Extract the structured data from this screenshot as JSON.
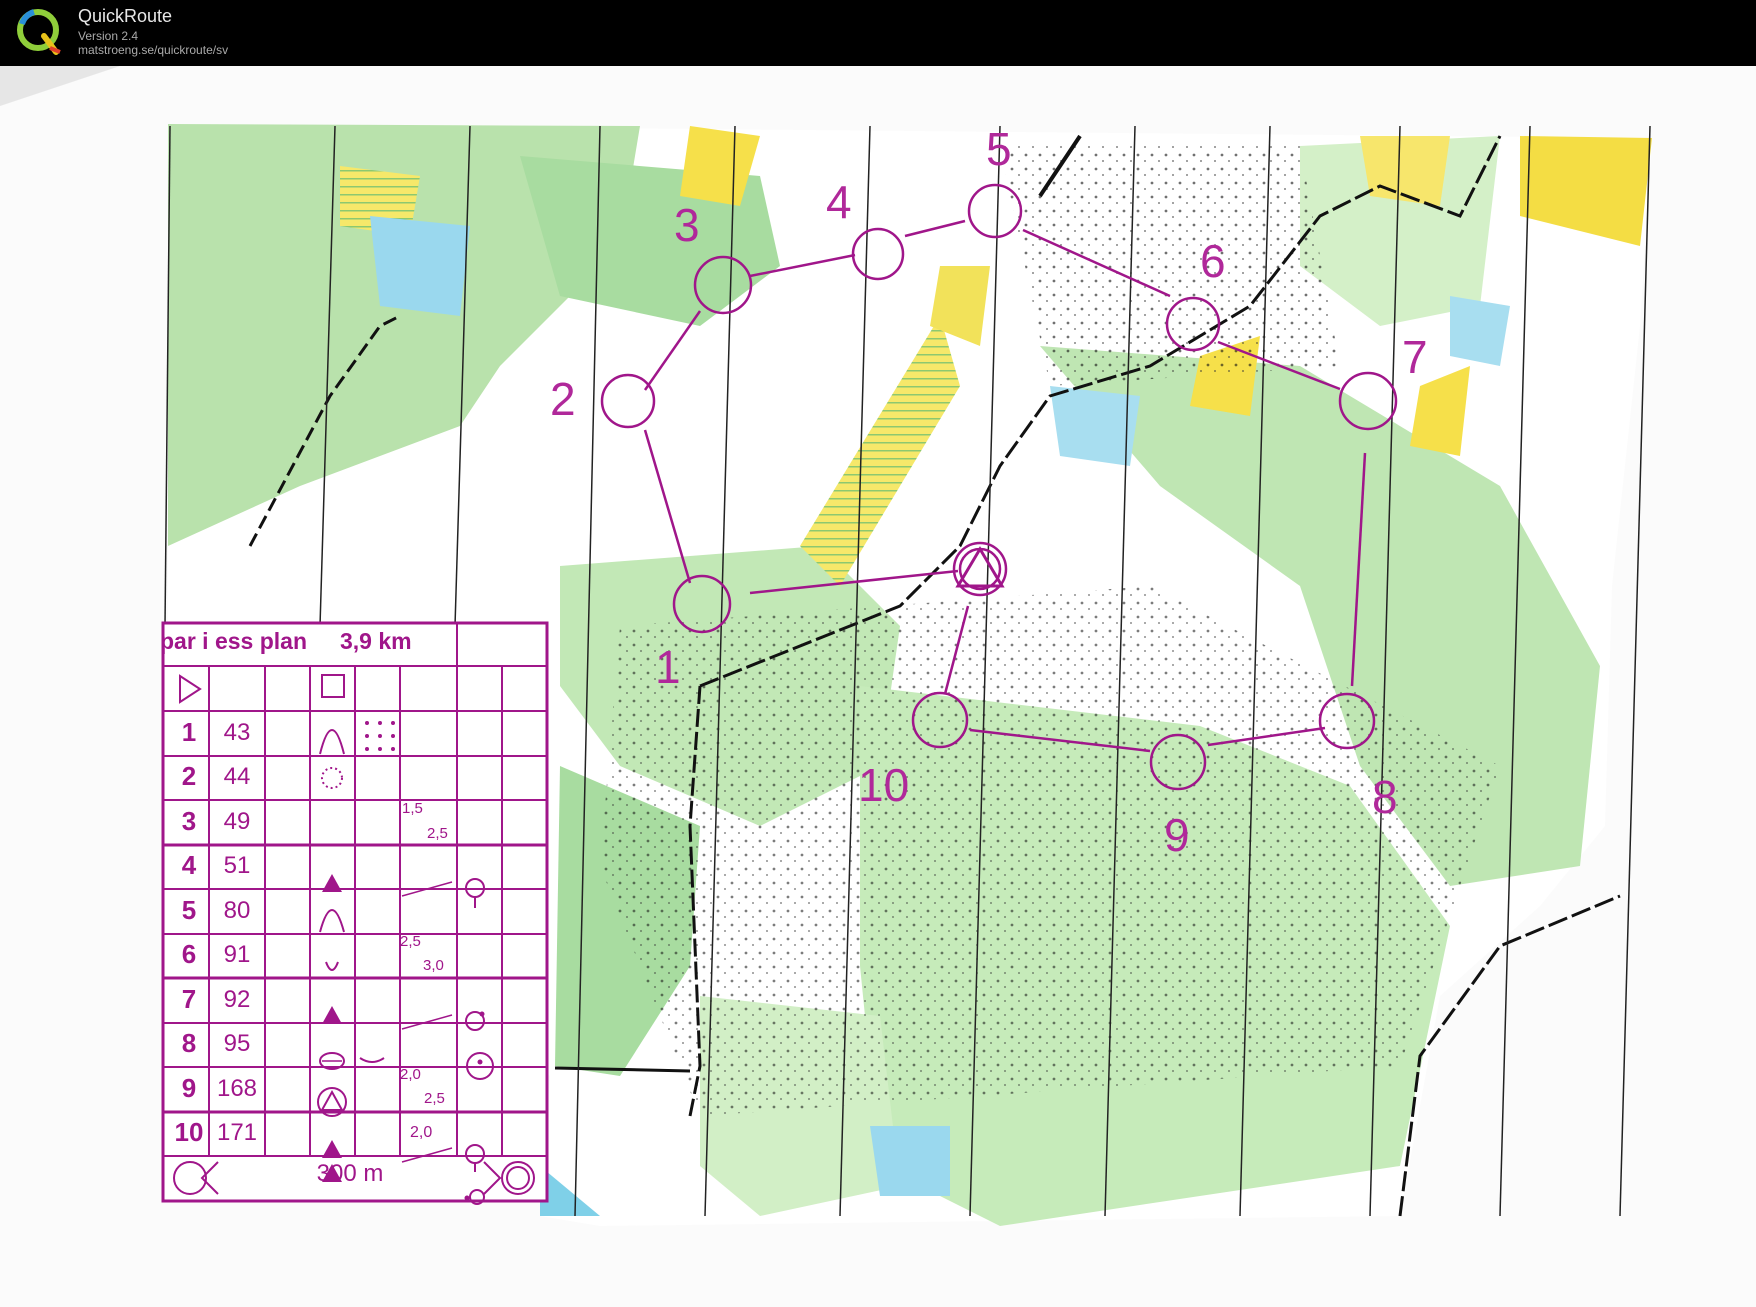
{
  "window": {
    "app_name": "QuickRoute",
    "version": "Version 2.4",
    "url": "matstroeng.se/quickroute/sv",
    "logo_letter": "Q"
  },
  "colors": {
    "course": "#a0168a",
    "forest_light": "#a8dca0",
    "open_land": "#f6e04a",
    "water": "#7fd0e8",
    "paper": "#ffffff",
    "titlebar": "#000000"
  },
  "course": {
    "title": "par i ess plan",
    "distance": "3,9 km",
    "scale_label": "300 m",
    "controls": [
      {
        "number": "1",
        "code": "43"
      },
      {
        "number": "2",
        "code": "44"
      },
      {
        "number": "3",
        "code": "49",
        "dimension": {
          "top": "1,5",
          "bottom": "2,5"
        }
      },
      {
        "number": "4",
        "code": "51"
      },
      {
        "number": "5",
        "code": "80"
      },
      {
        "number": "6",
        "code": "91",
        "dimension": {
          "top": "2,5",
          "bottom": "3,0"
        }
      },
      {
        "number": "7",
        "code": "92"
      },
      {
        "number": "8",
        "code": "95"
      },
      {
        "number": "9",
        "code": "168",
        "dimension": {
          "top": "2,0",
          "bottom": "2,5"
        }
      },
      {
        "number": "10",
        "code": "171",
        "dimension": {
          "top": "2,0",
          "bottom": ""
        }
      }
    ]
  },
  "map_control_labels": [
    "1",
    "2",
    "3",
    "4",
    "5",
    "6",
    "7",
    "8",
    "9",
    "10"
  ]
}
